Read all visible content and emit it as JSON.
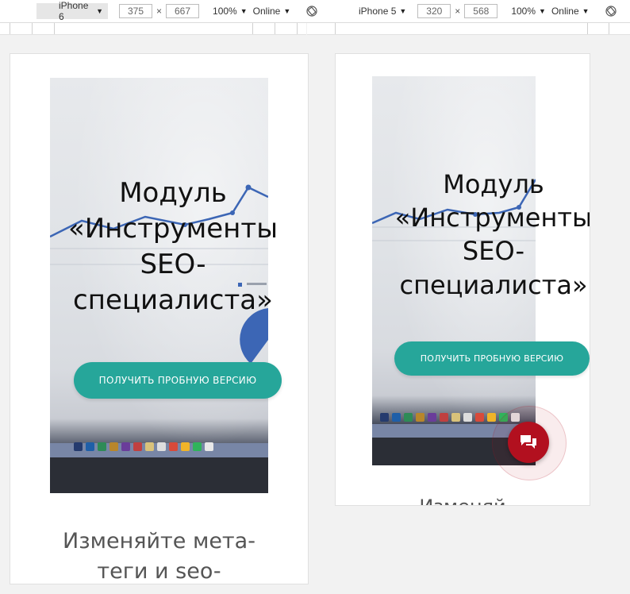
{
  "toolbar": {
    "left": {
      "device": "iPhone 6",
      "width": "375",
      "times": "×",
      "height": "667",
      "zoom": "100%",
      "network": "Online"
    },
    "right": {
      "device": "iPhone 5",
      "width": "320",
      "times": "×",
      "height": "568",
      "zoom": "100%",
      "network": "Online"
    }
  },
  "page": {
    "hero_title": "Модуль «Инструменты SEO-специалиста»",
    "cta_label": "ПОЛУЧИТЬ ПРОБНУЮ ВЕРСИЮ",
    "below_text": "Изменяйте мета-теги и seo-",
    "below_text_partial": "Изменяй"
  },
  "icons": {
    "rotate": "rotate-device-icon",
    "dropdown": "dropdown-arrow-icon",
    "chat": "chat-bubbles-icon"
  },
  "colors": {
    "cta": "#26a69a",
    "chat": "#b2101f"
  }
}
